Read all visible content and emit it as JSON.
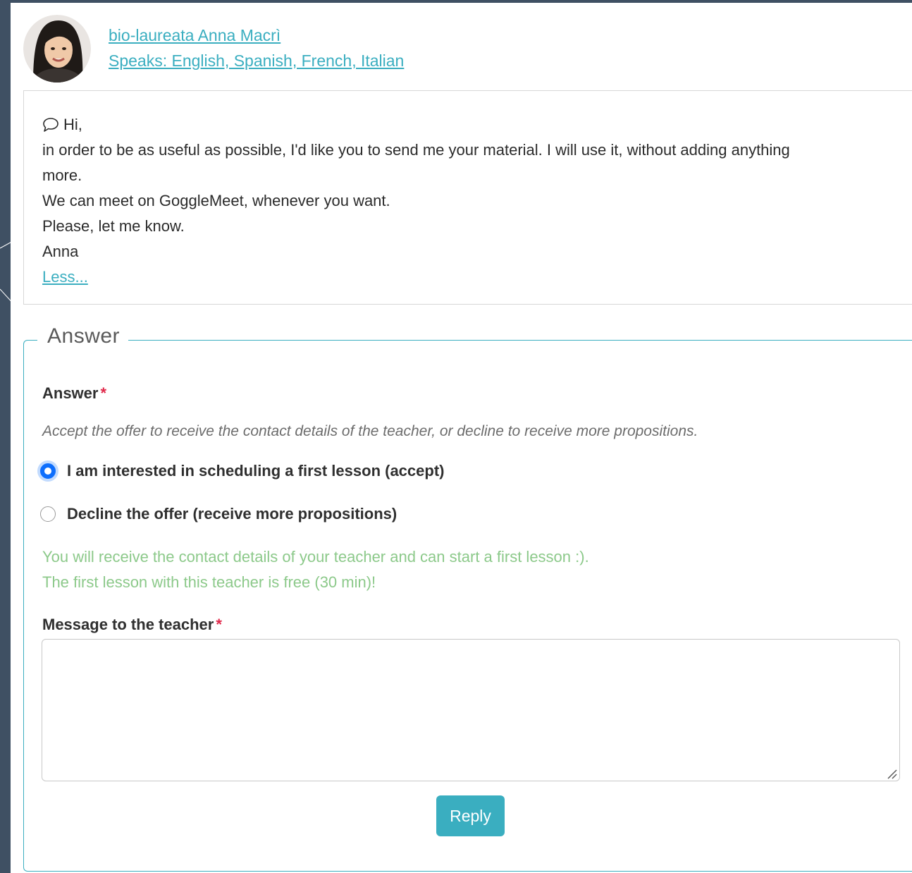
{
  "teacher": {
    "name_link": "bio-laureata Anna Macrì",
    "languages_link": "Speaks: English, Spanish, French, Italian"
  },
  "message": {
    "greeting": "Hi,",
    "lines": [
      "in order to be as useful as possible, I'd like you to send me your material. I will use it, without adding anything",
      "more.",
      "We can meet on GoggleMeet, whenever you want.",
      "Please, let me know.",
      "Anna"
    ],
    "less_link": "Less..."
  },
  "answer_section": {
    "legend": "Answer",
    "answer_label": "Answer",
    "required_mark": "*",
    "helper_text": "Accept the offer to receive the contact details of the teacher, or decline to receive more propositions.",
    "options": [
      {
        "label": "I am interested in scheduling a first lesson (accept)",
        "selected": true
      },
      {
        "label": "Decline the offer (receive more propositions)",
        "selected": false
      }
    ],
    "info_lines": [
      "You will receive the contact details of your teacher and can start a first lesson :).",
      "The first lesson with this teacher is free (30 min)!"
    ],
    "message_label": "Message to the teacher",
    "message_value": "",
    "reply_button": "Reply"
  },
  "colors": {
    "accent": "#3aaec0",
    "background": "#3f5063",
    "required": "#e0284a",
    "info_green": "#8cc98a",
    "radio_selected": "#0d6efd"
  },
  "icons": {
    "avatar": "teacher-avatar-photo",
    "greeting": "chat-bubble-icon",
    "textarea_resize": "resize-handle-icon"
  }
}
